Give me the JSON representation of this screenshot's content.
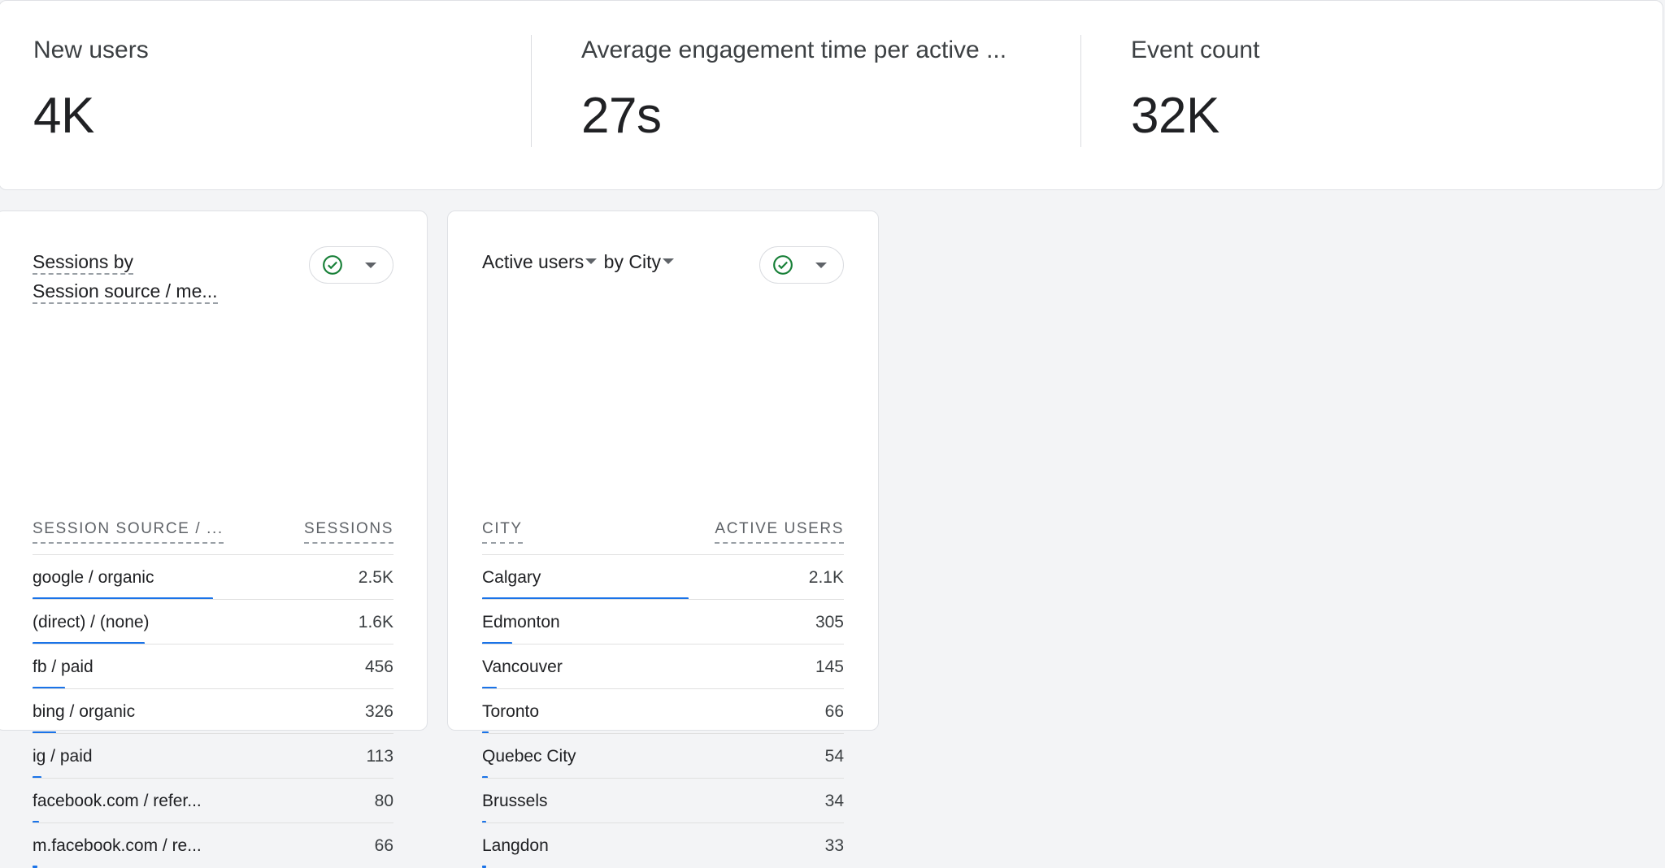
{
  "metrics": [
    {
      "label": "New users",
      "value": "4K"
    },
    {
      "label": "Average engagement time per active ...",
      "value": "27s"
    },
    {
      "label": "Event count",
      "value": "32K"
    }
  ],
  "sessions_card": {
    "title_line1": "Sessions by",
    "title_line2": "Session source / me...",
    "col_left": "SESSION SOURCE / ...",
    "col_right": "SESSIONS",
    "rows": [
      {
        "label": "google / organic",
        "value": "2.5K",
        "share": 0.5
      },
      {
        "label": "(direct) / (none)",
        "value": "1.6K",
        "share": 0.31
      },
      {
        "label": "fb / paid",
        "value": "456",
        "share": 0.09
      },
      {
        "label": "bing / organic",
        "value": "326",
        "share": 0.065
      },
      {
        "label": "ig / paid",
        "value": "113",
        "share": 0.025
      },
      {
        "label": "facebook.com / refer...",
        "value": "80",
        "share": 0.017
      },
      {
        "label": "m.facebook.com / re...",
        "value": "66",
        "share": 0.014
      }
    ]
  },
  "city_card": {
    "title_metric": "Active users",
    "title_by": "by",
    "title_dimension": "City",
    "col_left": "CITY",
    "col_right": "ACTIVE USERS",
    "rows": [
      {
        "label": "Calgary",
        "value": "2.1K",
        "share": 0.57
      },
      {
        "label": "Edmonton",
        "value": "305",
        "share": 0.083
      },
      {
        "label": "Vancouver",
        "value": "145",
        "share": 0.04
      },
      {
        "label": "Toronto",
        "value": "66",
        "share": 0.018
      },
      {
        "label": "Quebec City",
        "value": "54",
        "share": 0.015
      },
      {
        "label": "Brussels",
        "value": "34",
        "share": 0.01
      },
      {
        "label": "Langdon",
        "value": "33",
        "share": 0.009
      }
    ]
  },
  "colors": {
    "accent": "#1a73e8",
    "check": "#188038"
  },
  "icons": {
    "status": "check-circle-icon",
    "dropdown": "arrow-drop-down-icon"
  }
}
